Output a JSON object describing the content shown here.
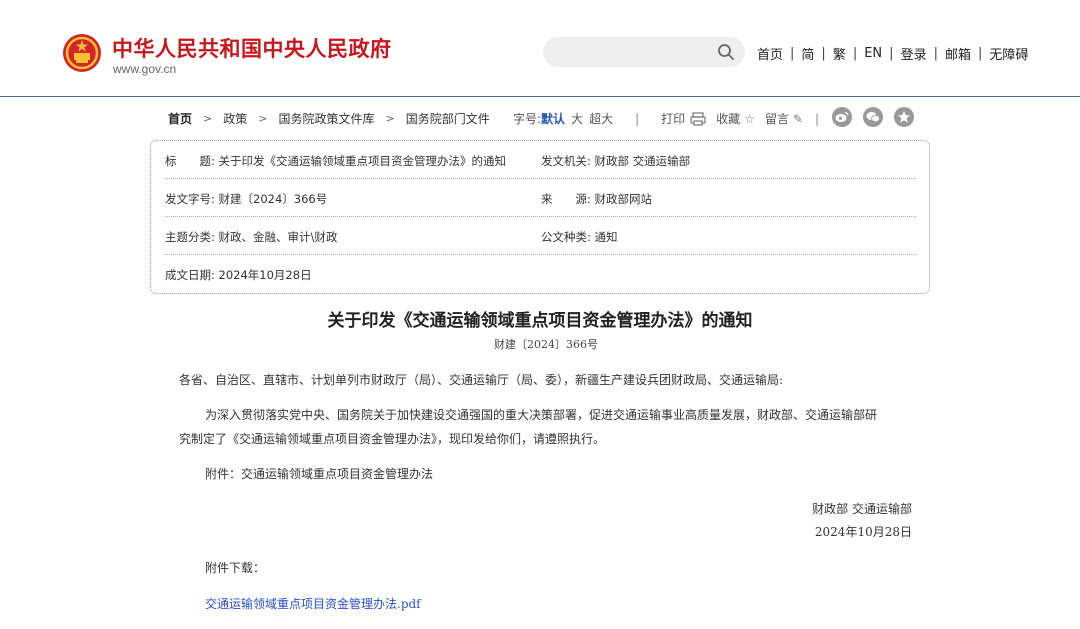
{
  "header": {
    "site_title": "中华人民共和国中央人民政府",
    "site_domain": "www.gov.cn",
    "search_placeholder": "",
    "nav": [
      "首页",
      "简",
      "繁",
      "EN",
      "登录",
      "邮箱",
      "无障碍"
    ]
  },
  "breadcrumb": [
    "首页",
    "政策",
    "国务院政策文件库",
    "国务院部门文件"
  ],
  "toolbar": {
    "font_label": "字号:",
    "font_default": "默认",
    "font_large": "大",
    "font_xlarge": "超大",
    "print": "打印",
    "favorite": "收藏",
    "comment": "留言"
  },
  "share_icons": [
    "weibo-icon",
    "wechat-icon",
    "qzone-icon"
  ],
  "info": {
    "title_label": "标　　题:",
    "title_value": "关于印发《交通运输领域重点项目资金管理办法》的通知",
    "issuer_label": "发文机关:",
    "issuer_value": "财政部 交通运输部",
    "doc_no_label": "发文字号:",
    "doc_no_value": "财建〔2024〕366号",
    "source_label": "来　　源:",
    "source_value": "财政部网站",
    "topic_label": "主题分类:",
    "topic_value": "财政、金融、审计\\财政",
    "type_label": "公文种类:",
    "type_value": "通知",
    "date_label": "成文日期:",
    "date_value": "2024年10月28日"
  },
  "article": {
    "title": "关于印发《交通运输领域重点项目资金管理办法》的通知",
    "number": "财建〔2024〕366号",
    "greeting": "各省、自治区、直辖市、计划单列市财政厅（局）、交通运输厅（局、委），新疆生产建设兵团财政局、交通运输局:",
    "body_line1": "为深入贯彻落实党中央、国务院关于加快建设交通强国的重大决策部署，促进交通运输事业高质量发展，财政部、交通运输部研",
    "body_line2": "究制定了《交通运输领域重点项目资金管理办法》，现印发给你们，请遵照执行。",
    "attachment": "附件：交通运输领域重点项目资金管理办法",
    "signer": "财政部 交通运输部",
    "sign_date": "2024年10月28日",
    "download_label": "附件下载：",
    "download_file": "交通运输领域重点项目资金管理办法.pdf"
  },
  "colors": {
    "brand_red": "#c8161d",
    "link_blue": "#2a4fc8",
    "active_blue": "#2a58b8"
  }
}
